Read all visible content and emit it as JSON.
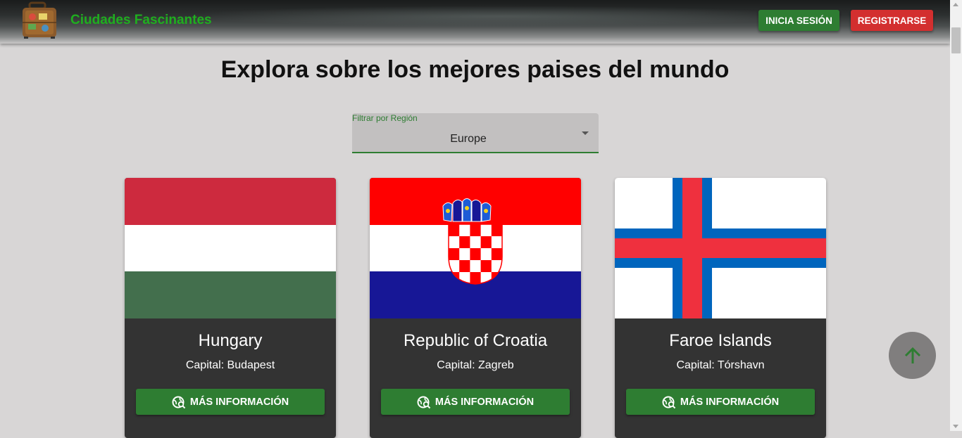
{
  "header": {
    "brand": "Ciudades Fascinantes",
    "login_label": "INICIA SESIÓN",
    "register_label": "REGISTRARSE"
  },
  "main": {
    "title": "Explora sobre los mejores paises del mundo",
    "filter": {
      "label": "Filtrar por Región",
      "value": "Europe"
    }
  },
  "countries": [
    {
      "name": "Hungary",
      "capital": "Capital: Budapest",
      "button": "MÁS INFORMACIÓN",
      "flag": "hungary-flag"
    },
    {
      "name": "Republic of Croatia",
      "capital": "Capital: Zagreb",
      "button": "MÁS INFORMACIÓN",
      "flag": "croatia-flag"
    },
    {
      "name": "Faroe Islands",
      "capital": "Capital: Tórshavn",
      "button": "MÁS INFORMACIÓN",
      "flag": "faroe-flag"
    }
  ],
  "colors": {
    "primary_green": "#2e7d32",
    "danger_red": "#d32f2f",
    "brand_green": "#1fae1f",
    "card_bg": "#333333",
    "page_bg": "#d8d6d6"
  },
  "icons": {
    "logo": "suitcase-icon",
    "info": "travel-explore-icon",
    "fab": "arrow-up-icon"
  }
}
